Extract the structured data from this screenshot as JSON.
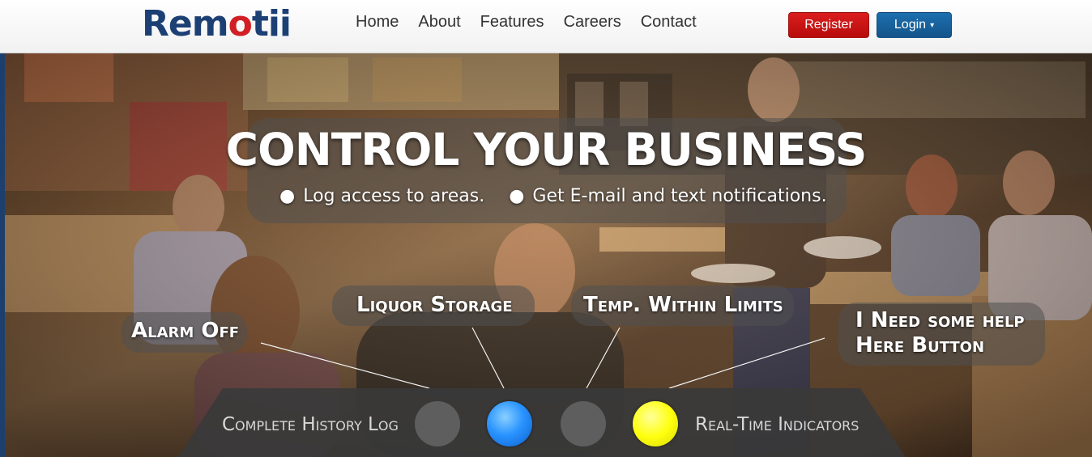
{
  "header": {
    "logo_prefix": "Rem",
    "logo_power": "o",
    "logo_suffix": "tii",
    "nav": [
      "Home",
      "About",
      "Features",
      "Careers",
      "Contact"
    ],
    "register_label": "Register",
    "login_label": "Login",
    "login_caret": "▾"
  },
  "hero": {
    "headline": "CONTROL YOUR BUSINESS",
    "bullets": [
      "Log access to areas.",
      "Get E-mail and text notifications."
    ],
    "labels": {
      "alarm_off": "Alarm Off",
      "liquor_storage": "Liquor Storage",
      "temp_within_limits": "Temp. Within Limits",
      "help_line1": "I Need some help",
      "help_line2": "Here Button"
    }
  },
  "panel": {
    "left_label": "Complete History Log",
    "right_label": "Real-Time Indicators",
    "indicators": [
      "gray",
      "blue",
      "gray",
      "yellow"
    ]
  },
  "colors": {
    "brand_blue": "#1c3f74",
    "brand_red": "#d11f25",
    "register": "#c61414",
    "login": "#1765a0",
    "indicator_blue": "#2a94ff",
    "indicator_yellow": "#ffff10",
    "indicator_gray": "#5e5e5e"
  }
}
